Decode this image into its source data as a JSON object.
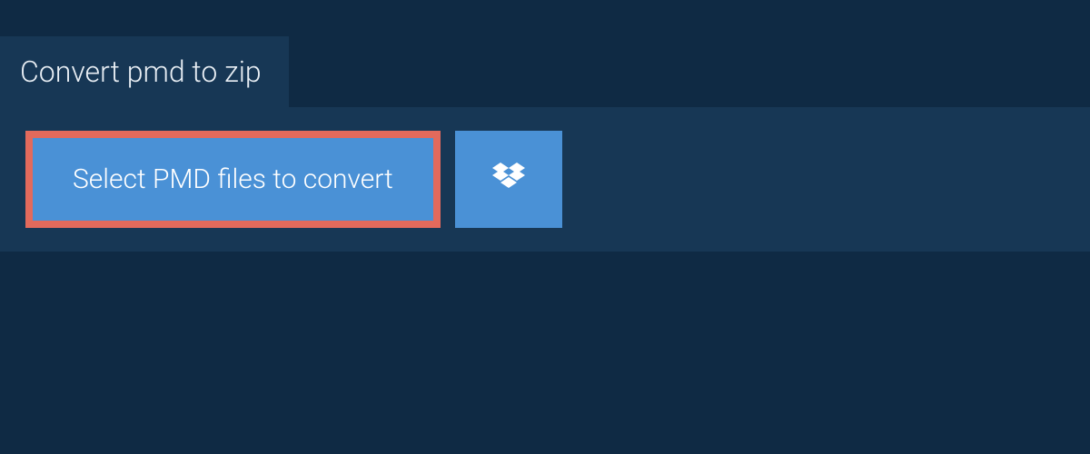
{
  "tab": {
    "title": "Convert pmd to zip"
  },
  "actions": {
    "select_label": "Select PMD files to convert"
  }
}
